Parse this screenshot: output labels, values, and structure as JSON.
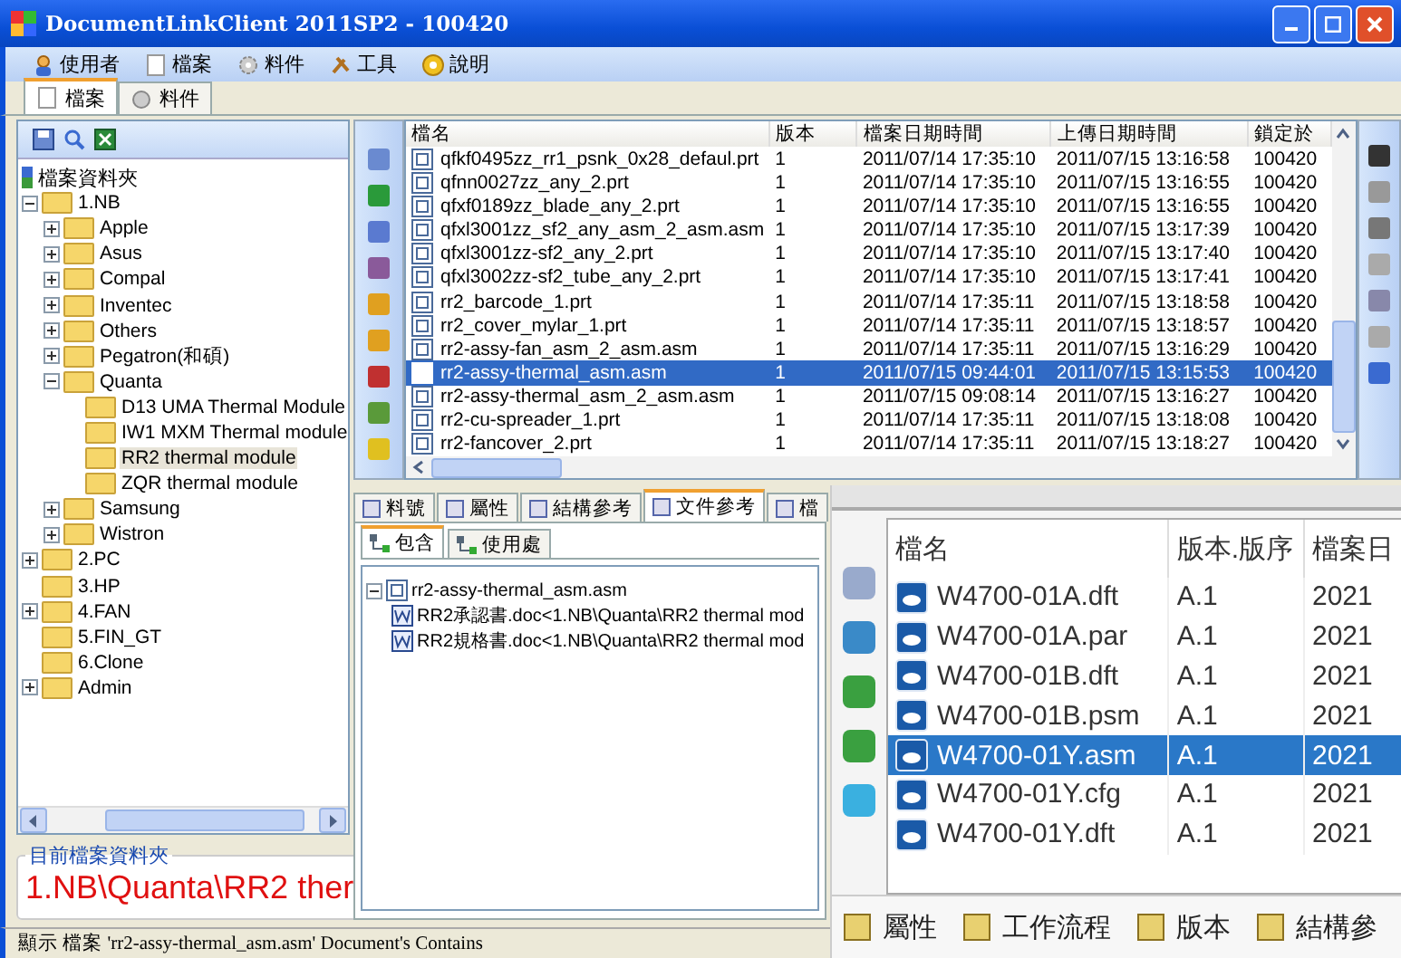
{
  "window": {
    "title": "DocumentLinkClient 2011SP2 - 100420"
  },
  "menu": [
    {
      "label": "使用者"
    },
    {
      "label": "檔案"
    },
    {
      "label": "料件"
    },
    {
      "label": "工具"
    },
    {
      "label": "說明"
    }
  ],
  "tabs": [
    {
      "label": "檔案",
      "selected": true
    },
    {
      "label": "料件",
      "selected": false
    }
  ],
  "folder_tree": {
    "root": "檔案資料夾",
    "items": [
      {
        "label": "1.NB",
        "expanded": true,
        "selected": false,
        "children": [
          {
            "label": "Apple",
            "expanded": false,
            "selected": false
          },
          {
            "label": "Asus",
            "expanded": false,
            "selected": false
          },
          {
            "label": "Compal",
            "expanded": false,
            "selected": false
          },
          {
            "label": "Inventec",
            "expanded": false,
            "selected": false
          },
          {
            "label": "Others",
            "expanded": false,
            "selected": false
          },
          {
            "label": "Pegatron(和碩)",
            "expanded": false,
            "selected": false
          },
          {
            "label": "Quanta",
            "expanded": true,
            "selected": false,
            "children": [
              {
                "label": "D13 UMA Thermal Module",
                "selected": false
              },
              {
                "label": "IW1 MXM Thermal module",
                "selected": false
              },
              {
                "label": "RR2 thermal module",
                "selected": true
              },
              {
                "label": "ZQR thermal module",
                "selected": false
              }
            ]
          },
          {
            "label": "Samsung",
            "expanded": false,
            "selected": false
          },
          {
            "label": "Wistron",
            "expanded": false,
            "selected": false
          }
        ]
      },
      {
        "label": "2.PC",
        "expanded": false,
        "selected": false
      },
      {
        "label": "3.HP",
        "selected": false
      },
      {
        "label": "4.FAN",
        "expanded": false,
        "selected": false
      },
      {
        "label": "5.FIN_GT",
        "selected": false
      },
      {
        "label": "6.Clone",
        "selected": false
      },
      {
        "label": "Admin",
        "expanded": false,
        "selected": false
      }
    ]
  },
  "current_folder": {
    "title": "目前檔案資料夾",
    "path": "1.NB\\Quanta\\RR2 ther"
  },
  "file_table": {
    "columns": [
      "檔名",
      "版本",
      "檔案日期時間",
      "上傳日期時間",
      "鎖定於"
    ],
    "rows": [
      {
        "name": "qfkf0495zz_rr1_psnk_0x28_defaul.prt",
        "version": "1",
        "file_time": "2011/07/14 17:35:10",
        "upload_time": "2011/07/15 13:16:58",
        "locked_at": "100420",
        "selected": false
      },
      {
        "name": "qfnn0027zz_any_2.prt",
        "version": "1",
        "file_time": "2011/07/14 17:35:10",
        "upload_time": "2011/07/15 13:16:55",
        "locked_at": "100420",
        "selected": false
      },
      {
        "name": "qfxf0189zz_blade_any_2.prt",
        "version": "1",
        "file_time": "2011/07/14 17:35:10",
        "upload_time": "2011/07/15 13:16:55",
        "locked_at": "100420",
        "selected": false
      },
      {
        "name": "qfxl3001zz_sf2_any_asm_2_asm.asm",
        "version": "1",
        "file_time": "2011/07/14 17:35:10",
        "upload_time": "2011/07/15 13:17:39",
        "locked_at": "100420",
        "selected": false
      },
      {
        "name": "qfxl3001zz-sf2_any_2.prt",
        "version": "1",
        "file_time": "2011/07/14 17:35:10",
        "upload_time": "2011/07/15 13:17:40",
        "locked_at": "100420",
        "selected": false
      },
      {
        "name": "qfxl3002zz-sf2_tube_any_2.prt",
        "version": "1",
        "file_time": "2011/07/14 17:35:10",
        "upload_time": "2011/07/15 13:17:41",
        "locked_at": "100420",
        "selected": false
      },
      {
        "name": "rr2_barcode_1.prt",
        "version": "1",
        "file_time": "2011/07/14 17:35:11",
        "upload_time": "2011/07/15 13:18:58",
        "locked_at": "100420",
        "selected": false
      },
      {
        "name": "rr2_cover_mylar_1.prt",
        "version": "1",
        "file_time": "2011/07/14 17:35:11",
        "upload_time": "2011/07/15 13:18:57",
        "locked_at": "100420",
        "selected": false
      },
      {
        "name": "rr2-assy-fan_asm_2_asm.asm",
        "version": "1",
        "file_time": "2011/07/14 17:35:11",
        "upload_time": "2011/07/15 13:16:29",
        "locked_at": "100420",
        "selected": false
      },
      {
        "name": "rr2-assy-thermal_asm.asm",
        "version": "1",
        "file_time": "2011/07/15 09:44:01",
        "upload_time": "2011/07/15 13:15:53",
        "locked_at": "100420",
        "selected": true
      },
      {
        "name": "rr2-assy-thermal_asm_2_asm.asm",
        "version": "1",
        "file_time": "2011/07/15 09:08:14",
        "upload_time": "2011/07/15 13:16:27",
        "locked_at": "100420",
        "selected": false
      },
      {
        "name": "rr2-cu-spreader_1.prt",
        "version": "1",
        "file_time": "2011/07/14 17:35:11",
        "upload_time": "2011/07/15 13:18:08",
        "locked_at": "100420",
        "selected": false
      },
      {
        "name": "rr2-fancover_2.prt",
        "version": "1",
        "file_time": "2011/07/14 17:35:11",
        "upload_time": "2011/07/15 13:18:27",
        "locked_at": "100420",
        "selected": false
      }
    ]
  },
  "detail_tabs": [
    {
      "label": "料號",
      "selected": false
    },
    {
      "label": "屬性",
      "selected": false
    },
    {
      "label": "結構參考",
      "selected": false
    },
    {
      "label": "文件參考",
      "selected": true
    },
    {
      "label": "檔",
      "selected": false
    }
  ],
  "reference_tabs": [
    {
      "label": "包含",
      "selected": true
    },
    {
      "label": "使用處",
      "selected": false
    }
  ],
  "reference_tree": {
    "label": "rr2-assy-thermal_asm.asm",
    "expanded": true,
    "children": [
      {
        "label": "RR2承認書.doc<1.NB\\Quanta\\RR2 thermal mod"
      },
      {
        "label": "RR2規格書.doc<1.NB\\Quanta\\RR2 thermal mod"
      }
    ]
  },
  "status_bar": "顯示 檔案 'rr2-assy-thermal_asm.asm' Document's Contains",
  "inset": {
    "columns": [
      "檔名",
      "版本.版序",
      "檔案日"
    ],
    "rows": [
      {
        "name": "W4700-01A.dft",
        "version": "A.1",
        "date": "2021",
        "selected": false
      },
      {
        "name": "W4700-01A.par",
        "version": "A.1",
        "date": "2021",
        "selected": false
      },
      {
        "name": "W4700-01B.dft",
        "version": "A.1",
        "date": "2021",
        "selected": false
      },
      {
        "name": "W4700-01B.psm",
        "version": "A.1",
        "date": "2021",
        "selected": false
      },
      {
        "name": "W4700-01Y.asm",
        "version": "A.1",
        "date": "2021",
        "selected": true
      },
      {
        "name": "W4700-01Y.cfg",
        "version": "A.1",
        "date": "2021",
        "selected": false
      },
      {
        "name": "W4700-01Y.dft",
        "version": "A.1",
        "date": "2021",
        "selected": false
      }
    ],
    "tabs": [
      {
        "label": "屬性"
      },
      {
        "label": "工作流程"
      },
      {
        "label": "版本"
      },
      {
        "label": "結構參"
      }
    ]
  }
}
